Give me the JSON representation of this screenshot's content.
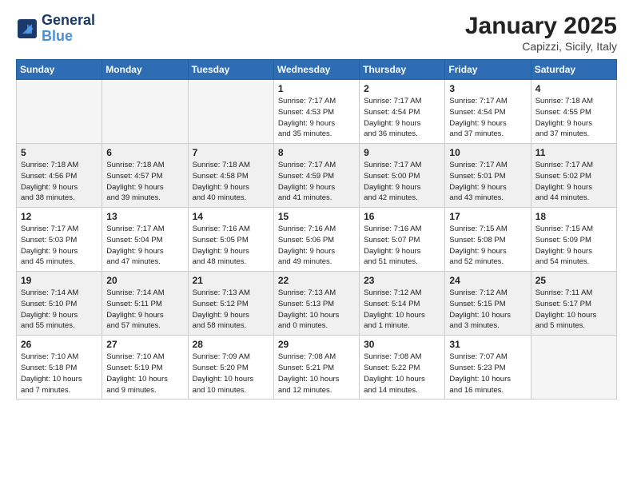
{
  "logo": {
    "line1": "General",
    "line2": "Blue"
  },
  "title": "January 2025",
  "location": "Capizzi, Sicily, Italy",
  "days_of_week": [
    "Sunday",
    "Monday",
    "Tuesday",
    "Wednesday",
    "Thursday",
    "Friday",
    "Saturday"
  ],
  "weeks": [
    [
      {
        "day": "",
        "info": ""
      },
      {
        "day": "",
        "info": ""
      },
      {
        "day": "",
        "info": ""
      },
      {
        "day": "1",
        "info": "Sunrise: 7:17 AM\nSunset: 4:53 PM\nDaylight: 9 hours\nand 35 minutes."
      },
      {
        "day": "2",
        "info": "Sunrise: 7:17 AM\nSunset: 4:54 PM\nDaylight: 9 hours\nand 36 minutes."
      },
      {
        "day": "3",
        "info": "Sunrise: 7:17 AM\nSunset: 4:54 PM\nDaylight: 9 hours\nand 37 minutes."
      },
      {
        "day": "4",
        "info": "Sunrise: 7:18 AM\nSunset: 4:55 PM\nDaylight: 9 hours\nand 37 minutes."
      }
    ],
    [
      {
        "day": "5",
        "info": "Sunrise: 7:18 AM\nSunset: 4:56 PM\nDaylight: 9 hours\nand 38 minutes."
      },
      {
        "day": "6",
        "info": "Sunrise: 7:18 AM\nSunset: 4:57 PM\nDaylight: 9 hours\nand 39 minutes."
      },
      {
        "day": "7",
        "info": "Sunrise: 7:18 AM\nSunset: 4:58 PM\nDaylight: 9 hours\nand 40 minutes."
      },
      {
        "day": "8",
        "info": "Sunrise: 7:17 AM\nSunset: 4:59 PM\nDaylight: 9 hours\nand 41 minutes."
      },
      {
        "day": "9",
        "info": "Sunrise: 7:17 AM\nSunset: 5:00 PM\nDaylight: 9 hours\nand 42 minutes."
      },
      {
        "day": "10",
        "info": "Sunrise: 7:17 AM\nSunset: 5:01 PM\nDaylight: 9 hours\nand 43 minutes."
      },
      {
        "day": "11",
        "info": "Sunrise: 7:17 AM\nSunset: 5:02 PM\nDaylight: 9 hours\nand 44 minutes."
      }
    ],
    [
      {
        "day": "12",
        "info": "Sunrise: 7:17 AM\nSunset: 5:03 PM\nDaylight: 9 hours\nand 45 minutes."
      },
      {
        "day": "13",
        "info": "Sunrise: 7:17 AM\nSunset: 5:04 PM\nDaylight: 9 hours\nand 47 minutes."
      },
      {
        "day": "14",
        "info": "Sunrise: 7:16 AM\nSunset: 5:05 PM\nDaylight: 9 hours\nand 48 minutes."
      },
      {
        "day": "15",
        "info": "Sunrise: 7:16 AM\nSunset: 5:06 PM\nDaylight: 9 hours\nand 49 minutes."
      },
      {
        "day": "16",
        "info": "Sunrise: 7:16 AM\nSunset: 5:07 PM\nDaylight: 9 hours\nand 51 minutes."
      },
      {
        "day": "17",
        "info": "Sunrise: 7:15 AM\nSunset: 5:08 PM\nDaylight: 9 hours\nand 52 minutes."
      },
      {
        "day": "18",
        "info": "Sunrise: 7:15 AM\nSunset: 5:09 PM\nDaylight: 9 hours\nand 54 minutes."
      }
    ],
    [
      {
        "day": "19",
        "info": "Sunrise: 7:14 AM\nSunset: 5:10 PM\nDaylight: 9 hours\nand 55 minutes."
      },
      {
        "day": "20",
        "info": "Sunrise: 7:14 AM\nSunset: 5:11 PM\nDaylight: 9 hours\nand 57 minutes."
      },
      {
        "day": "21",
        "info": "Sunrise: 7:13 AM\nSunset: 5:12 PM\nDaylight: 9 hours\nand 58 minutes."
      },
      {
        "day": "22",
        "info": "Sunrise: 7:13 AM\nSunset: 5:13 PM\nDaylight: 10 hours\nand 0 minutes."
      },
      {
        "day": "23",
        "info": "Sunrise: 7:12 AM\nSunset: 5:14 PM\nDaylight: 10 hours\nand 1 minute."
      },
      {
        "day": "24",
        "info": "Sunrise: 7:12 AM\nSunset: 5:15 PM\nDaylight: 10 hours\nand 3 minutes."
      },
      {
        "day": "25",
        "info": "Sunrise: 7:11 AM\nSunset: 5:17 PM\nDaylight: 10 hours\nand 5 minutes."
      }
    ],
    [
      {
        "day": "26",
        "info": "Sunrise: 7:10 AM\nSunset: 5:18 PM\nDaylight: 10 hours\nand 7 minutes."
      },
      {
        "day": "27",
        "info": "Sunrise: 7:10 AM\nSunset: 5:19 PM\nDaylight: 10 hours\nand 9 minutes."
      },
      {
        "day": "28",
        "info": "Sunrise: 7:09 AM\nSunset: 5:20 PM\nDaylight: 10 hours\nand 10 minutes."
      },
      {
        "day": "29",
        "info": "Sunrise: 7:08 AM\nSunset: 5:21 PM\nDaylight: 10 hours\nand 12 minutes."
      },
      {
        "day": "30",
        "info": "Sunrise: 7:08 AM\nSunset: 5:22 PM\nDaylight: 10 hours\nand 14 minutes."
      },
      {
        "day": "31",
        "info": "Sunrise: 7:07 AM\nSunset: 5:23 PM\nDaylight: 10 hours\nand 16 minutes."
      },
      {
        "day": "",
        "info": ""
      }
    ]
  ]
}
